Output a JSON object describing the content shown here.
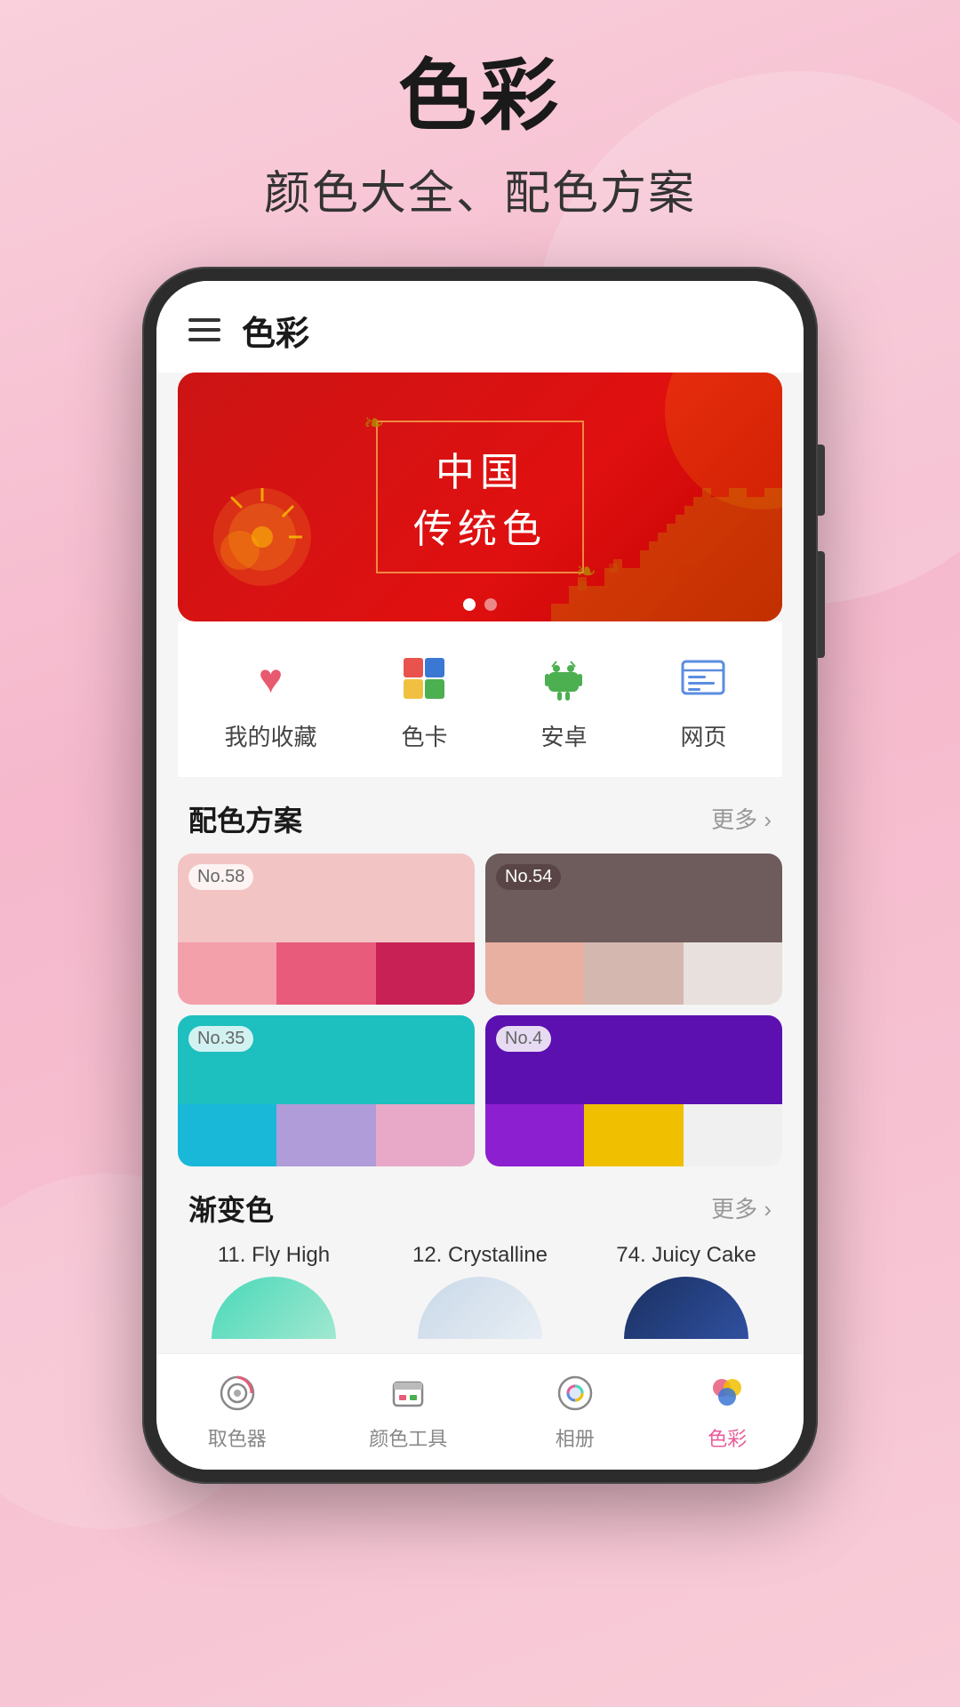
{
  "page": {
    "title": "色彩",
    "subtitle": "颜色大全、配色方案"
  },
  "app": {
    "topbar": {
      "title": "色彩"
    },
    "banner": {
      "line1": "中国",
      "line2": "传统色",
      "dots": [
        true,
        false
      ]
    },
    "quicknav": {
      "items": [
        {
          "label": "我的收藏",
          "icon": "♥",
          "color": "#e85a6f"
        },
        {
          "label": "色卡",
          "icon": "🎨",
          "color": "#e8534d"
        },
        {
          "label": "安卓",
          "icon": "🤖",
          "color": "#4caf50"
        },
        {
          "label": "网页",
          "icon": "🗒",
          "color": "#5b8de0"
        }
      ]
    },
    "palette_section": {
      "title": "配色方案",
      "more": "更多 ›",
      "cards": [
        {
          "number": "No.58",
          "main_color": "#f2c4c4",
          "swatches": [
            "#f4a0ab",
            "#e85b7a",
            "#c82155"
          ]
        },
        {
          "number": "No.54",
          "main_color": "#6e5b5b",
          "swatches": [
            "#e8b0a0",
            "#d4b8b0",
            "#e8e0dc"
          ]
        },
        {
          "number": "No.35",
          "main_color": "#1ebfbf",
          "swatches": [
            "#1ab8d8",
            "#b09cd8",
            "#e8a8c8"
          ]
        },
        {
          "number": "No.4",
          "main_color": "#5c10b0",
          "swatches": [
            "#8c20d0",
            "#f0c000",
            "#f0f0f0"
          ]
        }
      ]
    },
    "gradient_section": {
      "title": "渐变色",
      "more": "更多 ›",
      "items": [
        {
          "label": "11. Fly High",
          "colors": [
            "#48d8b8",
            "#a0e8d0"
          ]
        },
        {
          "label": "12. Crystalline",
          "colors": [
            "#c8d8e8",
            "#e8eef4"
          ]
        },
        {
          "label": "74. Juicy Cake",
          "colors": [
            "#1a3060",
            "#3050a0"
          ]
        }
      ]
    },
    "bottomnav": {
      "items": [
        {
          "label": "取色器",
          "icon": "🎨",
          "active": false
        },
        {
          "label": "颜色工具",
          "icon": "🧰",
          "active": false
        },
        {
          "label": "相册",
          "icon": "🔮",
          "active": false
        },
        {
          "label": "色彩",
          "icon": "🌈",
          "active": true
        }
      ]
    }
  }
}
